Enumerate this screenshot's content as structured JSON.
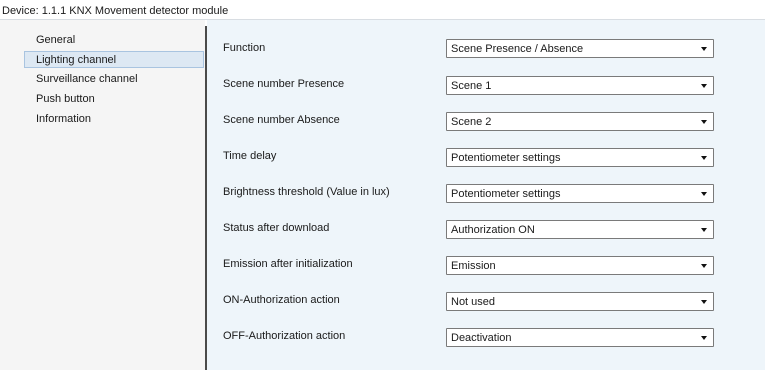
{
  "window": {
    "title": "Device: 1.1.1  KNX Movement detector module"
  },
  "sidebar": {
    "items": [
      {
        "label": "General"
      },
      {
        "label": "Lighting channel",
        "selected": true
      },
      {
        "label": "Surveillance channel"
      },
      {
        "label": "Push button"
      },
      {
        "label": "Information"
      }
    ]
  },
  "parameters": [
    {
      "label": "Function",
      "value": "Scene Presence / Absence"
    },
    {
      "label": "Scene number Presence",
      "value": "Scene 1"
    },
    {
      "label": "Scene number Absence",
      "value": "Scene 2"
    },
    {
      "label": "Time delay",
      "value": "Potentiometer settings"
    },
    {
      "label": "Brightness threshold (Value in lux)",
      "value": "Potentiometer settings"
    },
    {
      "label": "Status after download",
      "value": "Authorization ON"
    },
    {
      "label": "Emission after initialization",
      "value": "Emission"
    },
    {
      "label": "ON-Authorization action",
      "value": "Not used"
    },
    {
      "label": "OFF-Authorization action",
      "value": "Deactivation"
    }
  ],
  "icons": {
    "dropdown": "chevron-down-icon"
  }
}
